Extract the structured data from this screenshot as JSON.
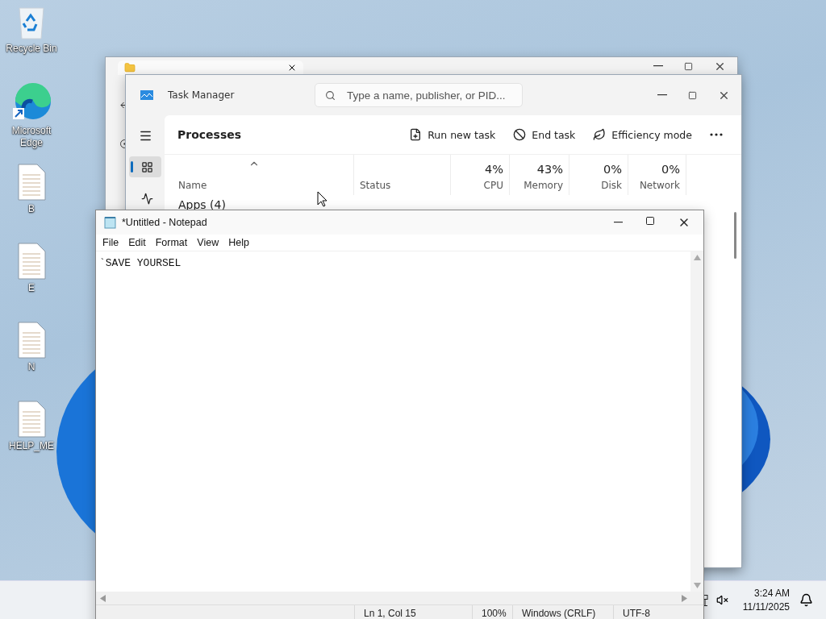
{
  "desktop_icons": [
    {
      "label": "Recycle Bin",
      "kind": "recycle"
    },
    {
      "label": "Microsoft\nEdge",
      "kind": "browser"
    },
    {
      "label": "B",
      "kind": "file"
    },
    {
      "label": "E",
      "kind": "file"
    },
    {
      "label": "N",
      "kind": "file"
    },
    {
      "label": "HELP_ME",
      "kind": "file"
    }
  ],
  "task_manager": {
    "title": "Task Manager",
    "search": {
      "placeholder": "Type a name, publisher, or PID..."
    },
    "nav": [
      {
        "kind": "processes",
        "selected": true
      },
      {
        "kind": "performance",
        "selected": false
      }
    ],
    "page_title": "Processes",
    "commands": [
      {
        "kind": "run",
        "label": "Run new task"
      },
      {
        "kind": "end",
        "label": "End task"
      },
      {
        "kind": "efficiency",
        "label": "Efficiency mode"
      },
      {
        "kind": "more"
      }
    ],
    "columns": [
      {
        "label": "Name"
      },
      {
        "label": "Status"
      },
      {
        "label": "CPU",
        "reading": "4%"
      },
      {
        "label": "Memory",
        "reading": "43%"
      },
      {
        "label": "Disk",
        "reading": "0%"
      },
      {
        "label": "Network",
        "reading": "0%"
      }
    ],
    "group": "Apps (4)"
  },
  "notepad": {
    "title": "*Untitled - Notepad",
    "menu": [
      "File",
      "Edit",
      "Format",
      "View",
      "Help"
    ],
    "text": "`SAVE YOURSEL",
    "status": [
      "Ln 1, Col 15",
      "100%",
      "Windows (CRLF)",
      "UTF-8"
    ]
  },
  "taskbar": {
    "time": "3:24 AM",
    "date": "11/11/2025"
  }
}
